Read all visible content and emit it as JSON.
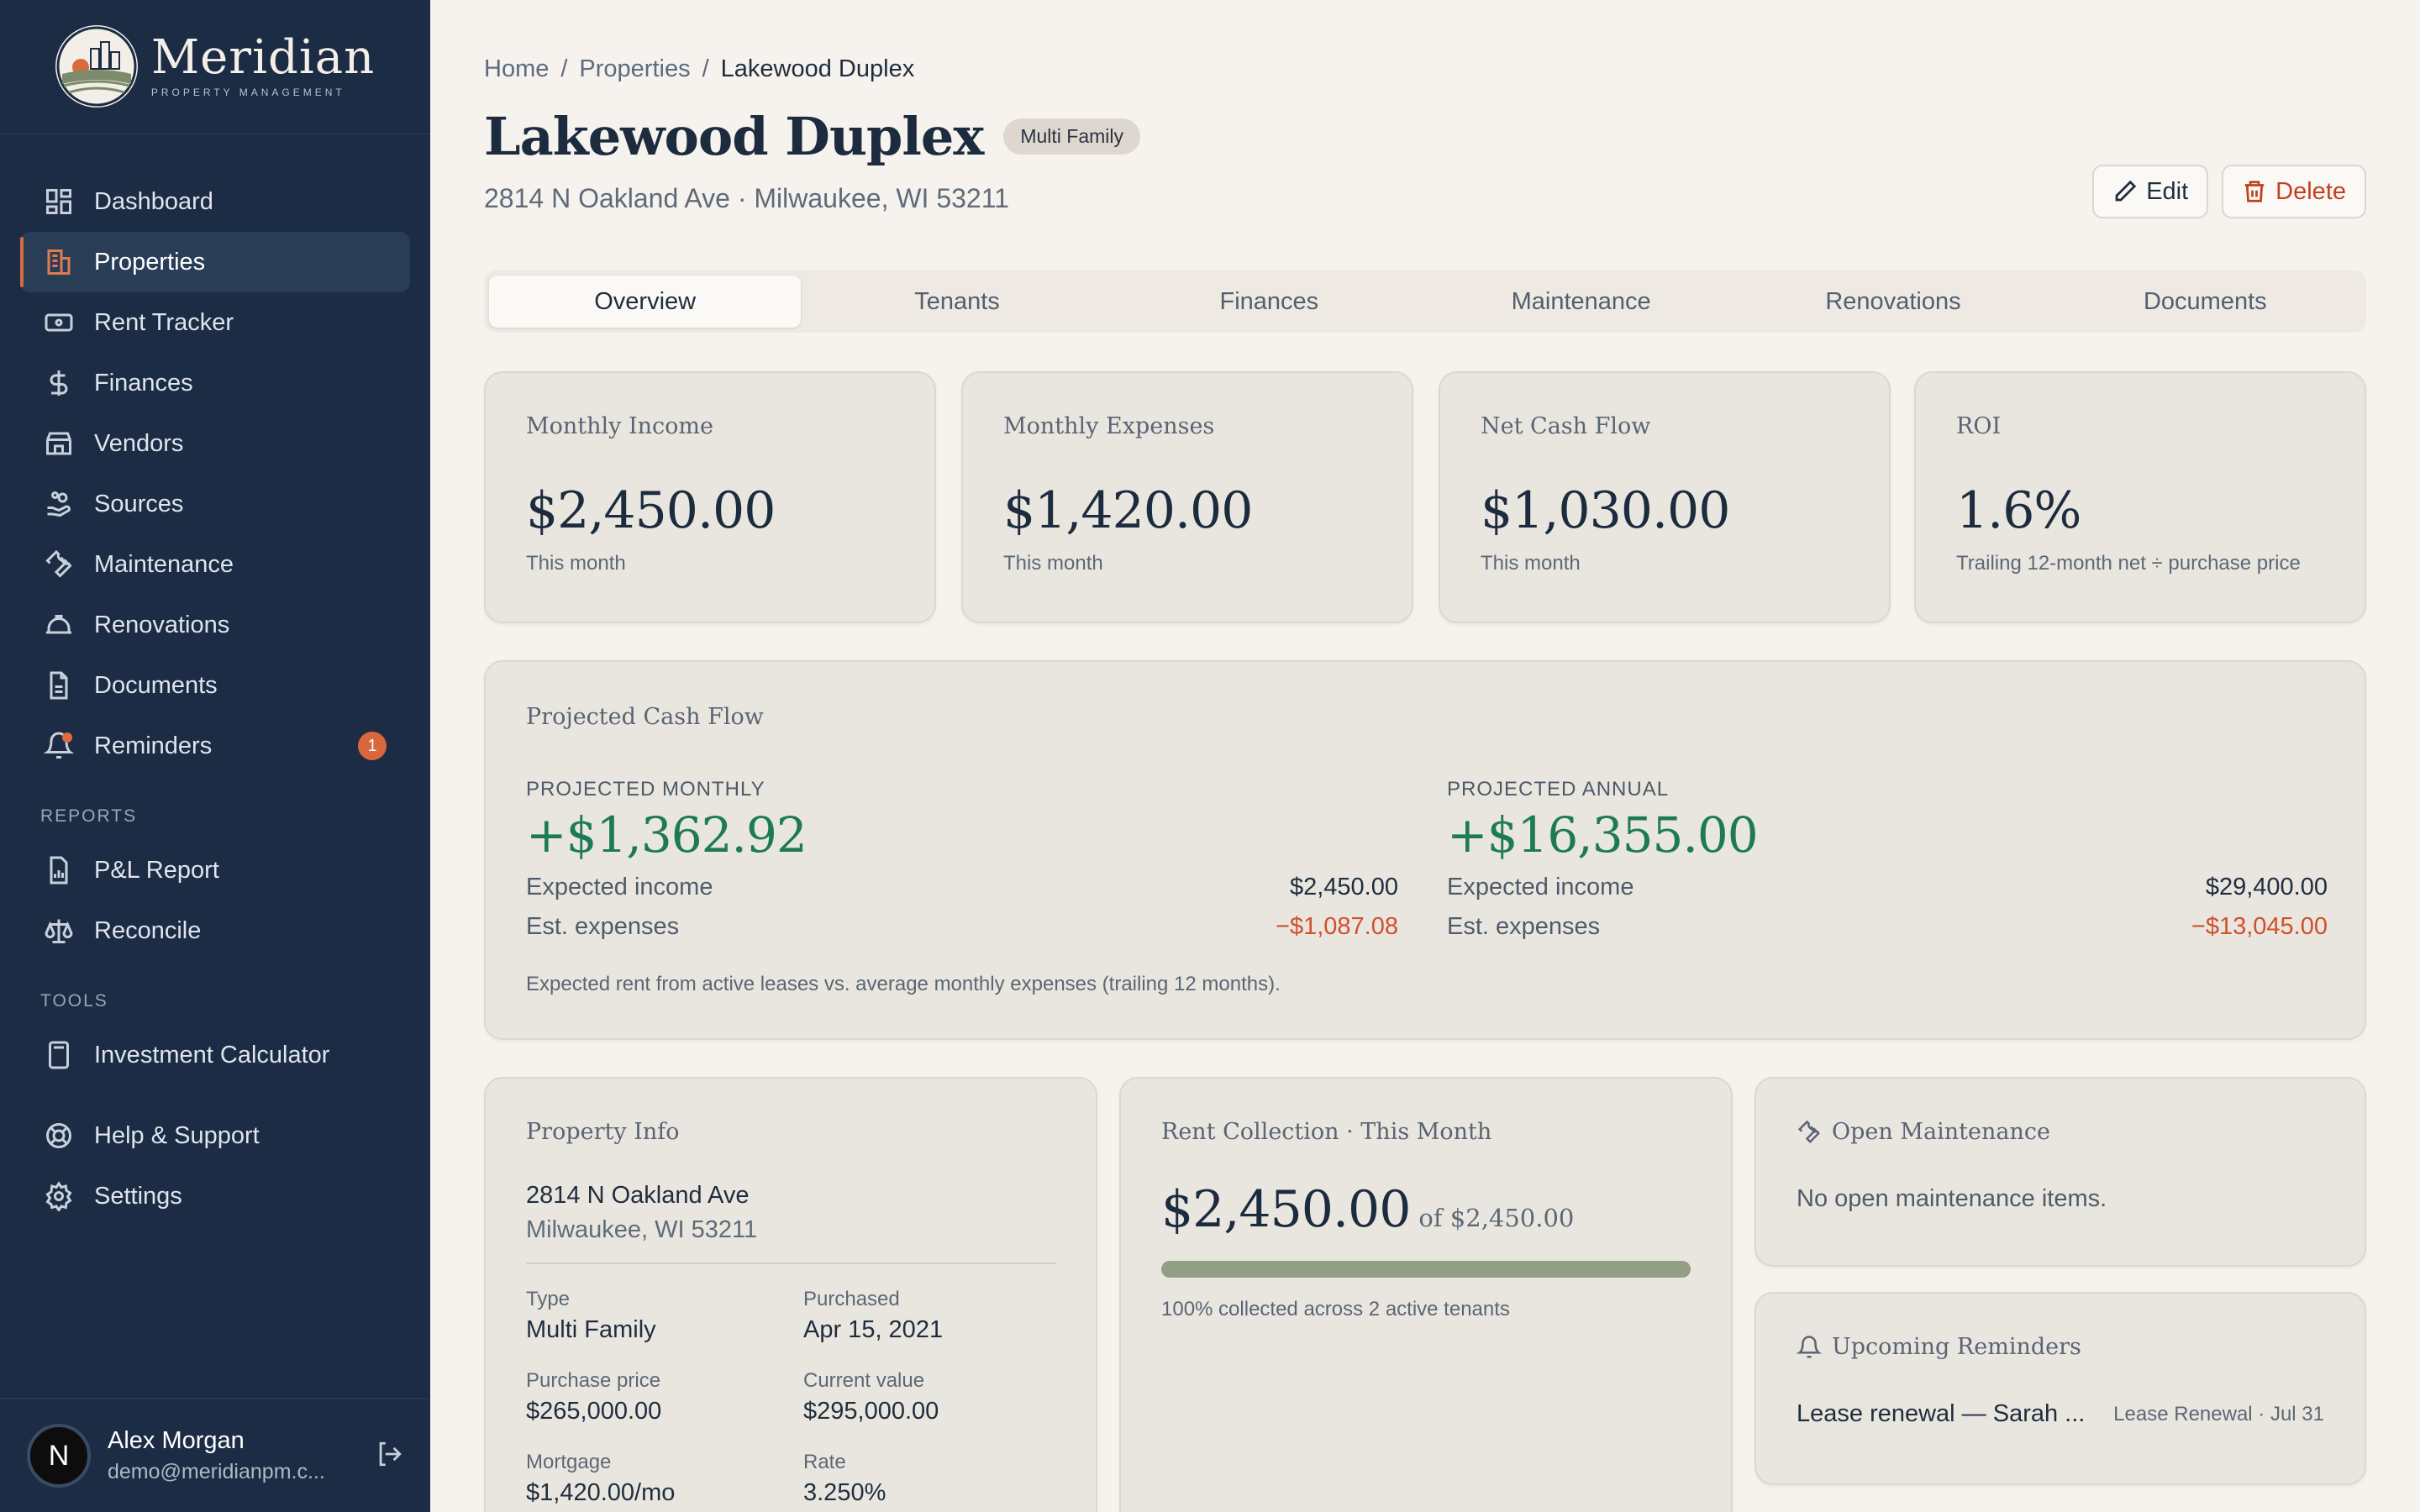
{
  "brand": {
    "name": "Meridian",
    "tagline": "PROPERTY MANAGEMENT"
  },
  "sidebar": {
    "items": [
      {
        "label": "Dashboard",
        "icon": "dashboard-icon"
      },
      {
        "label": "Properties",
        "icon": "building-icon",
        "active": true
      },
      {
        "label": "Rent Tracker",
        "icon": "banknote-icon"
      },
      {
        "label": "Finances",
        "icon": "dollar-icon"
      },
      {
        "label": "Vendors",
        "icon": "store-icon"
      },
      {
        "label": "Sources",
        "icon": "hand-coins-icon"
      },
      {
        "label": "Maintenance",
        "icon": "wrench-icon"
      },
      {
        "label": "Renovations",
        "icon": "hard-hat-icon"
      },
      {
        "label": "Documents",
        "icon": "document-icon"
      },
      {
        "label": "Reminders",
        "icon": "bell-icon",
        "badge": "1"
      }
    ],
    "reports_heading": "REPORTS",
    "reports": [
      {
        "label": "P&L Report",
        "icon": "report-icon"
      },
      {
        "label": "Reconcile",
        "icon": "scale-icon"
      }
    ],
    "tools_heading": "TOOLS",
    "tools": [
      {
        "label": "Investment Calculator",
        "icon": "calculator-icon"
      }
    ],
    "footer_items": [
      {
        "label": "Help & Support",
        "icon": "lifebuoy-icon"
      },
      {
        "label": "Settings",
        "icon": "gear-icon"
      }
    ]
  },
  "user": {
    "initial": "N",
    "name": "Alex Morgan",
    "email": "demo@meridianpm.c..."
  },
  "breadcrumb": {
    "home": "Home",
    "sep": "/",
    "properties": "Properties",
    "current": "Lakewood Duplex"
  },
  "page": {
    "title": "Lakewood Duplex",
    "type_badge": "Multi Family",
    "address": "2814 N Oakland Ave · Milwaukee, WI 53211",
    "edit_label": "Edit",
    "delete_label": "Delete"
  },
  "tabs": [
    "Overview",
    "Tenants",
    "Finances",
    "Maintenance",
    "Renovations",
    "Documents"
  ],
  "active_tab": "Overview",
  "stats": [
    {
      "label": "Monthly Income",
      "value": "$2,450.00",
      "sub": "This month"
    },
    {
      "label": "Monthly Expenses",
      "value": "$1,420.00",
      "sub": "This month"
    },
    {
      "label": "Net Cash Flow",
      "value": "$1,030.00",
      "sub": "This month"
    },
    {
      "label": "ROI",
      "value": "1.6%",
      "sub": "Trailing 12-month net ÷ purchase price"
    }
  ],
  "projection": {
    "title": "Projected Cash Flow",
    "monthly": {
      "label": "PROJECTED MONTHLY",
      "value": "+$1,362.92",
      "income_label": "Expected income",
      "income": "$2,450.00",
      "expense_label": "Est. expenses",
      "expense": "−$1,087.08"
    },
    "annual": {
      "label": "PROJECTED ANNUAL",
      "value": "+$16,355.00",
      "income_label": "Expected income",
      "income": "$29,400.00",
      "expense_label": "Est. expenses",
      "expense": "−$13,045.00"
    },
    "note": "Expected rent from active leases vs. average monthly expenses (trailing 12 months)."
  },
  "property_info": {
    "title": "Property Info",
    "street": "2814 N Oakland Ave",
    "city": "Milwaukee, WI 53211",
    "fields": [
      {
        "label": "Type",
        "value": "Multi Family"
      },
      {
        "label": "Purchased",
        "value": "Apr 15, 2021"
      },
      {
        "label": "Purchase price",
        "value": "$265,000.00"
      },
      {
        "label": "Current value",
        "value": "$295,000.00"
      },
      {
        "label": "Mortgage",
        "value": "$1,420.00/mo"
      },
      {
        "label": "Rate",
        "value": "3.250%"
      }
    ]
  },
  "rent_collection": {
    "title": "Rent Collection · This Month",
    "collected": "$2,450.00",
    "of_total": "of $2,450.00",
    "progress_fraction": 1.0,
    "note": "100% collected across 2 active tenants"
  },
  "maintenance": {
    "title": "Open Maintenance",
    "empty": "No open maintenance items."
  },
  "reminders": {
    "title": "Upcoming Reminders",
    "items": [
      {
        "text": "Lease renewal — Sarah ...",
        "meta": "Lease Renewal · Jul 31"
      }
    ]
  },
  "colors": {
    "sidebar": "#1b2c44",
    "accent": "#d86a3f",
    "positive": "#1e7a56",
    "negative": "#d0502a",
    "background": "#f6f2ed"
  }
}
